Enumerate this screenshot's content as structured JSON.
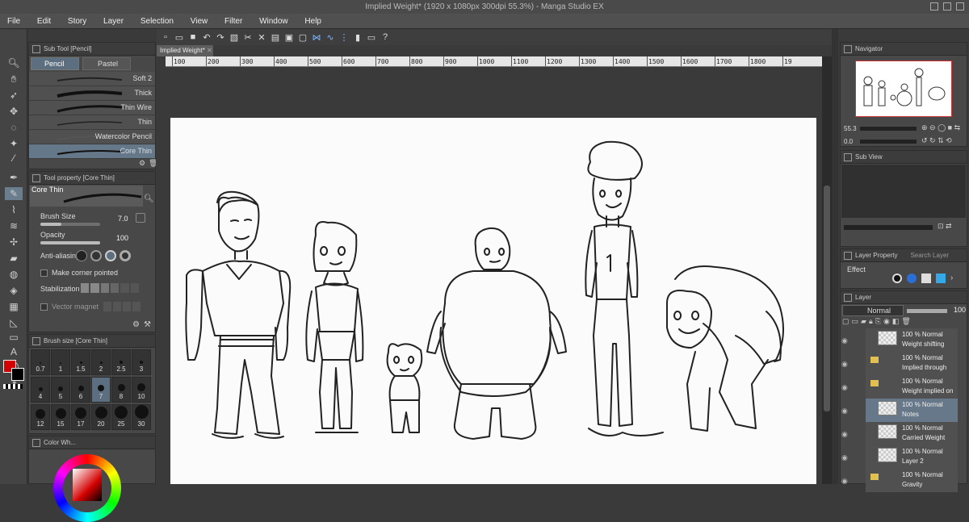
{
  "window": {
    "title": "Implied Weight* (1920 x 1080px 300dpi 55.3%) - Manga Studio EX"
  },
  "menu": [
    "File",
    "Edit",
    "Story",
    "Layer",
    "Selection",
    "View",
    "Filter",
    "Window",
    "Help"
  ],
  "doc_tab": "Implied Weight*",
  "ruler": [
    "100",
    "200",
    "300",
    "400",
    "500",
    "600",
    "700",
    "800",
    "900",
    "1000",
    "1100",
    "1200",
    "1300",
    "1400",
    "1500",
    "1600",
    "1700",
    "1800",
    "19"
  ],
  "subtool": {
    "title": "Sub Tool [Pencil]",
    "tabs": [
      "Pencil",
      "Pastel"
    ],
    "brushes": [
      "Soft 2",
      "Thick",
      "Thin Wire",
      "Thin",
      "Watercolor Pencil",
      "Core Thin"
    ]
  },
  "toolprop": {
    "title": "Tool property [Core Thin]",
    "preset": "Core Thin",
    "brush_size_label": "Brush Size",
    "brush_size_value": "7.0",
    "brush_size_level": 0.35,
    "opacity_label": "Opacity",
    "opacity_value": "100",
    "opacity_level": 1.0,
    "antialias_label": "Anti-aliasing",
    "corner_label": "Make corner pointed",
    "stabilization_label": "Stabilization",
    "vector_label": "Vector magnet"
  },
  "brushsize": {
    "title": "Brush size [Core Thin]",
    "sizes": [
      "0.7",
      "1",
      "1.5",
      "2",
      "2.5",
      "3",
      "4",
      "5",
      "6",
      "7",
      "8",
      "10",
      "12",
      "15",
      "17",
      "20",
      "25",
      "30"
    ],
    "selected": "7"
  },
  "colorwheel": {
    "title": "Color Wh..."
  },
  "navigator": {
    "title": "Navigator",
    "zoom": "55.3",
    "angle": "0.0"
  },
  "subview": {
    "title": "Sub View"
  },
  "layerprop": {
    "title": "Layer Property",
    "search_tab": "Search Layer",
    "effect_label": "Effect"
  },
  "layers": {
    "title": "Layer",
    "blend_mode": "Normal",
    "opacity": "100",
    "rows": [
      {
        "pct": "100 %",
        "mode": "Normal",
        "name": "Weight shifting",
        "type": "layer"
      },
      {
        "pct": "100 %",
        "mode": "Normal",
        "name": "Implied through",
        "type": "folder"
      },
      {
        "pct": "100 %",
        "mode": "Normal",
        "name": "Weight implied on",
        "type": "folder"
      },
      {
        "pct": "100 %",
        "mode": "Normal",
        "name": "Notes",
        "type": "layer"
      },
      {
        "pct": "100 %",
        "mode": "Normal",
        "name": "Carried Weight",
        "type": "layer"
      },
      {
        "pct": "100 %",
        "mode": "Normal",
        "name": "Layer 2",
        "type": "layer"
      },
      {
        "pct": "100 %",
        "mode": "Normal",
        "name": "Gravity",
        "type": "folder"
      }
    ]
  },
  "colors": {
    "main": "#d40000",
    "sub": "#000000",
    "accent": "#64788a"
  }
}
